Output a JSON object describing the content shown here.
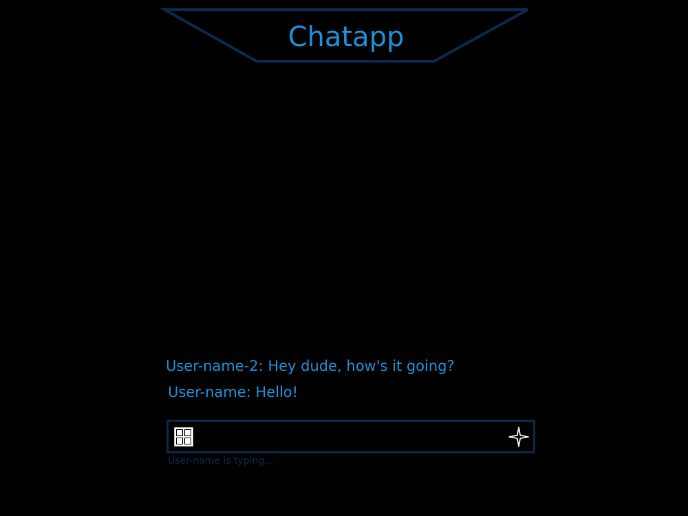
{
  "app": {
    "title": "Chatapp"
  },
  "messages": [
    {
      "text": "User-name-2: Hey dude, how's it going?"
    },
    {
      "text": "User-name: Hello!"
    }
  ],
  "composer": {
    "value": "",
    "placeholder": "",
    "emoji_icon": "grid-icon",
    "send_icon": "sparkle-send-icon"
  },
  "status": {
    "typing": "User-name is typing..."
  },
  "colors": {
    "background": "#000000",
    "accent": "#1a8fd6",
    "border": "#0b2a4a"
  }
}
